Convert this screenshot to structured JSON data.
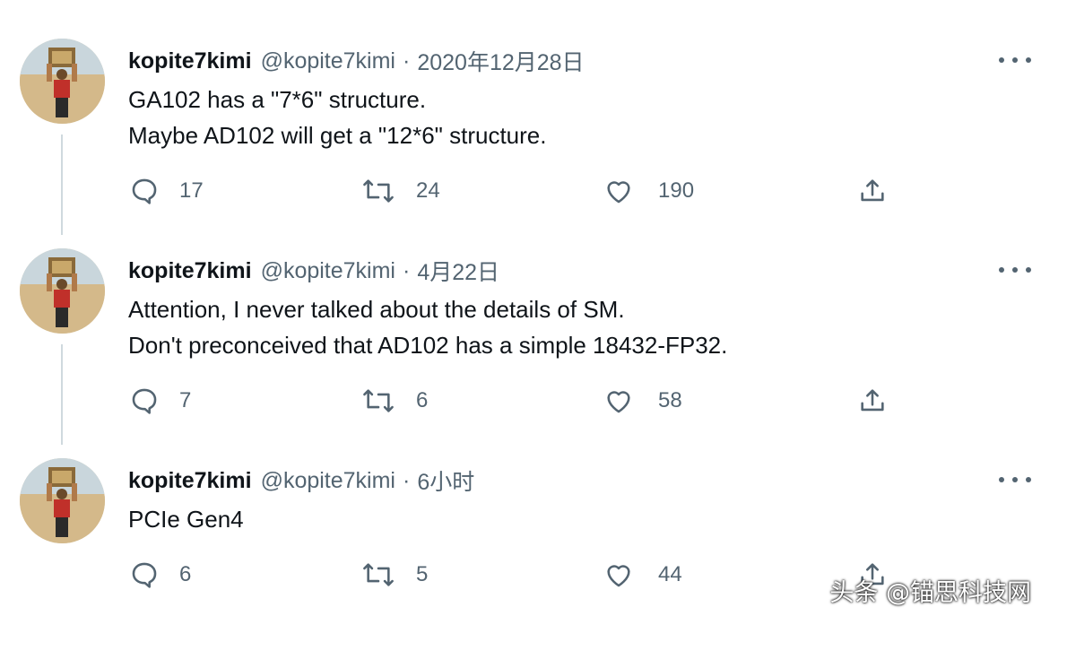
{
  "tweets": [
    {
      "name": "kopite7kimi",
      "handle": "@kopite7kimi",
      "separator": "·",
      "time": "2020年12月28日",
      "lines": [
        "GA102 has a \"7*6\" structure.",
        "Maybe AD102 will get a \"12*6\" structure."
      ],
      "replies": "17",
      "retweets": "24",
      "likes": "190"
    },
    {
      "name": "kopite7kimi",
      "handle": "@kopite7kimi",
      "separator": "·",
      "time": "4月22日",
      "lines": [
        "Attention, I never talked about the details of SM.",
        "Don't preconceived that AD102 has a simple 18432-FP32."
      ],
      "replies": "7",
      "retweets": "6",
      "likes": "58"
    },
    {
      "name": "kopite7kimi",
      "handle": "@kopite7kimi",
      "separator": "·",
      "time": "6小时",
      "lines": [
        "PCIe Gen4"
      ],
      "replies": "6",
      "retweets": "5",
      "likes": "44"
    }
  ],
  "icons": {
    "reply": "reply-icon",
    "retweet": "retweet-icon",
    "like": "heart-icon",
    "share": "share-icon",
    "more": "more-options-icon",
    "avatar": "avatar-image"
  },
  "watermark": "头条 @锚思科技网",
  "colors": {
    "text": "#0f1419",
    "secondary": "#536471",
    "thread_line": "#cfd9de"
  }
}
